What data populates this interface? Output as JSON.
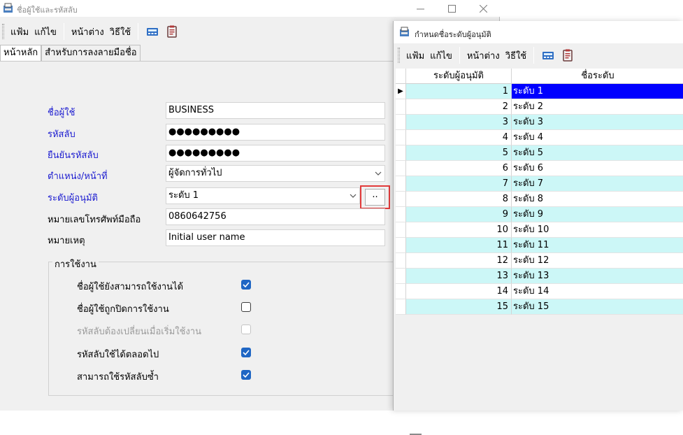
{
  "main_window": {
    "title": "ชื่อผู้ใช้และรหัสลับ",
    "menu": [
      "แฟ้ม",
      "แก้ไข",
      "หน้าต่าง",
      "วิธีใช้"
    ],
    "tabs": [
      "หน้าหลัก",
      "สำหรับการลงลายมือชื่อ"
    ],
    "fields": {
      "username": {
        "label": "ชื่อผู้ใช้",
        "value": "BUSINESS"
      },
      "password": {
        "label": "รหัสลับ",
        "value": "●●●●●●●●●"
      },
      "confirm_password": {
        "label": "ยืนยันรหัสลับ",
        "value": "●●●●●●●●●"
      },
      "position": {
        "label": "ตำแหน่ง/หน้าที่",
        "value": "ผู้จัดการทั่วไป"
      },
      "approval_level": {
        "label": "ระดับผู้อนุมัติ",
        "value": "ระดับ 1",
        "button_label": ".."
      },
      "mobile": {
        "label": "หมายเลขโทรศัพท์มือถือ",
        "value": "0860642756"
      },
      "note": {
        "label": "หมายเหตุ",
        "value": "Initial user name"
      }
    },
    "usage_group": {
      "title": "การใช้งาน",
      "options": [
        {
          "label": "ชื่อผู้ใช้ยังสามารถใช้งานได้",
          "checked": true,
          "disabled": false
        },
        {
          "label": "ชื่อผู้ใช้ถูกปิดการใช้งาน",
          "checked": false,
          "disabled": false
        },
        {
          "label": "รหัสลับต้องเปลี่ยนเมื่อเริ่มใช้งาน",
          "checked": false,
          "disabled": true
        },
        {
          "label": "รหัสลับใช้ได้ตลอดไป",
          "checked": true,
          "disabled": false
        },
        {
          "label": "สามารถใช้รหัสลับซ้ำ",
          "checked": true,
          "disabled": false
        }
      ]
    }
  },
  "level_window": {
    "title": "กำหนดชื่อระดับผู้อนุมัติ",
    "menu": [
      "แฟ้ม",
      "แก้ไข",
      "หน้าต่าง",
      "วิธีใช้"
    ],
    "columns": [
      "ระดับผู้อนุมัติ",
      "ชื่อระดับ"
    ],
    "rows": [
      {
        "level": "1",
        "name": "ระดับ 1"
      },
      {
        "level": "2",
        "name": "ระดับ 2"
      },
      {
        "level": "3",
        "name": "ระดับ 3"
      },
      {
        "level": "4",
        "name": "ระดับ 4"
      },
      {
        "level": "5",
        "name": "ระดับ 5"
      },
      {
        "level": "6",
        "name": "ระดับ 6"
      },
      {
        "level": "7",
        "name": "ระดับ 7"
      },
      {
        "level": "8",
        "name": "ระดับ 8"
      },
      {
        "level": "9",
        "name": "ระดับ 9"
      },
      {
        "level": "10",
        "name": "ระดับ 10"
      },
      {
        "level": "11",
        "name": "ระดับ 11"
      },
      {
        "level": "12",
        "name": "ระดับ 12"
      },
      {
        "level": "13",
        "name": "ระดับ 13"
      },
      {
        "level": "14",
        "name": "ระดับ 14"
      },
      {
        "level": "15",
        "name": "ระดับ 15"
      }
    ],
    "current_row_marker": "▶",
    "selected_row": 1
  },
  "colors": {
    "label_blue": "#1a1ad0",
    "row_alt": "#ccf7f7",
    "selection": "#0000ff",
    "checkbox_on": "#1f66c4",
    "highlight": "#e23b3b"
  },
  "icons": [
    "app-icon",
    "minimize-icon",
    "maximize-icon",
    "close-icon",
    "calculator-icon",
    "clipboard-icon",
    "chevron-down-icon",
    "checkmark-icon",
    "row-pointer-icon"
  ]
}
